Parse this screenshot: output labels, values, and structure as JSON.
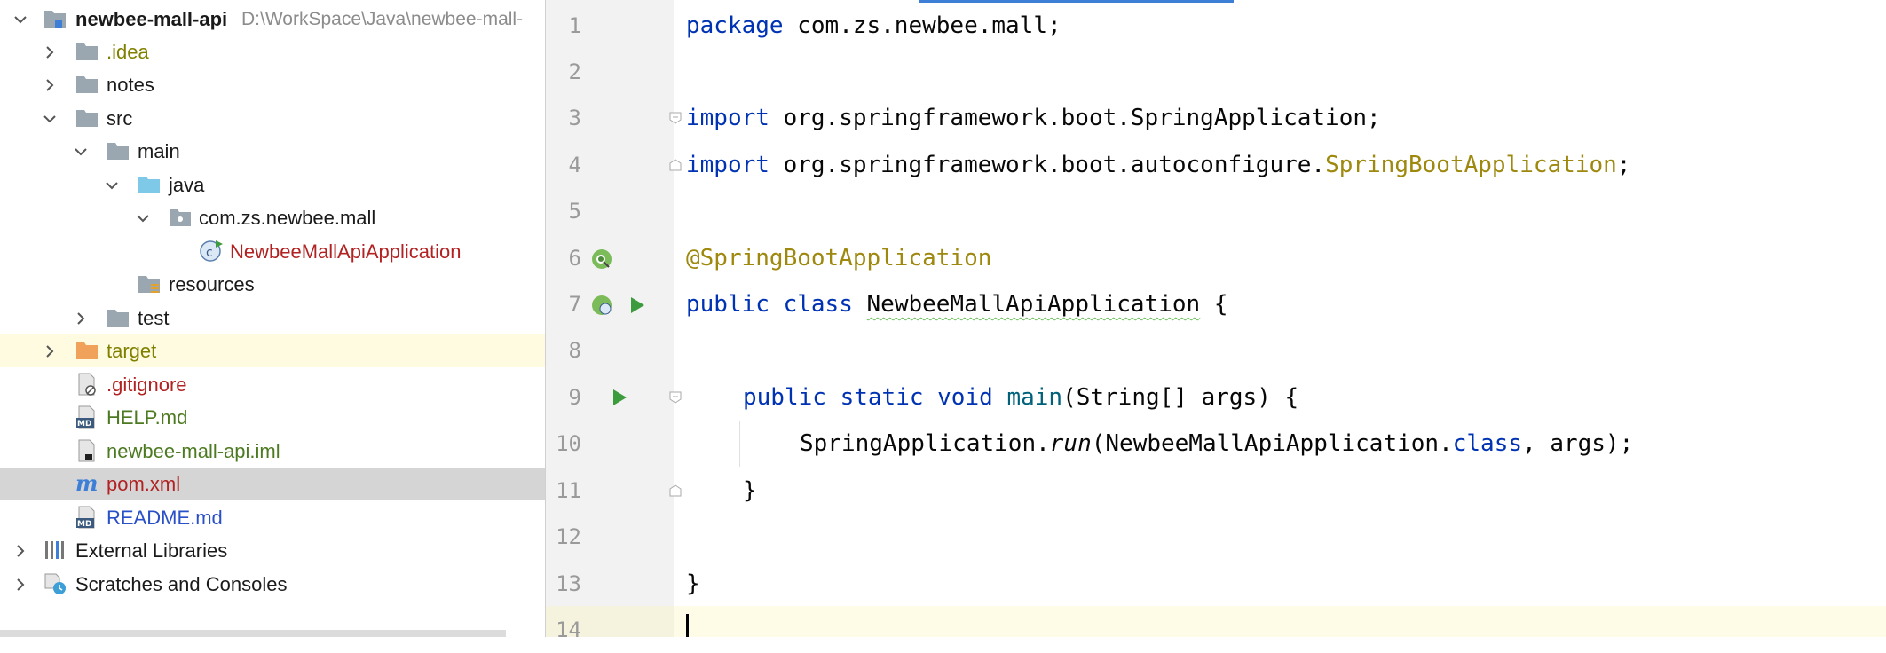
{
  "tree": {
    "root": {
      "label": "newbee-mall-api",
      "path": "D:\\WorkSpace\\Java\\newbee-mall-"
    },
    "items": [
      {
        "label": ".idea"
      },
      {
        "label": "notes"
      },
      {
        "label": "src"
      },
      {
        "label": "main"
      },
      {
        "label": "java"
      },
      {
        "label": "com.zs.newbee.mall"
      },
      {
        "label": "NewbeeMallApiApplication"
      },
      {
        "label": "resources"
      },
      {
        "label": "test"
      },
      {
        "label": "target"
      },
      {
        "label": ".gitignore"
      },
      {
        "label": "HELP.md"
      },
      {
        "label": "newbee-mall-api.iml"
      },
      {
        "label": "pom.xml"
      },
      {
        "label": "README.md"
      },
      {
        "label": "External Libraries"
      },
      {
        "label": "Scratches and Consoles"
      }
    ]
  },
  "editor": {
    "line_numbers": [
      "1",
      "2",
      "3",
      "4",
      "5",
      "6",
      "7",
      "8",
      "9",
      "10",
      "11",
      "12",
      "13",
      "14"
    ],
    "tokens": {
      "l1_kw": "package",
      "l1_rest": " com.zs.newbee.mall;",
      "l3_kw": "import",
      "l3_rest": " org.springframework.boot.SpringApplication;",
      "l4_kw": "import",
      "l4_rest": " org.springframework.boot.autoconfigure.",
      "l4_type": "SpringBootApplication",
      "l4_end": ";",
      "l6_ann": "@SpringBootApplication",
      "l7_kw1": "public",
      "l7_kw2": "class",
      "l7_name": "NewbeeMallApiApplication",
      "l7_end": " {",
      "l9_kw1": "public",
      "l9_kw2": "static",
      "l9_kw3": "void",
      "l9_fn": "main",
      "l9_rest": "(String[] args) {",
      "l10_cls": "SpringApplication.",
      "l10_fn": "run",
      "l10_mid": "(NewbeeMallApiApplication.",
      "l10_kw": "class",
      "l10_end": ", args);",
      "l11": "}",
      "l13": "}"
    }
  },
  "colors": {
    "keyword": "#0033b3",
    "annotation": "#9e880d",
    "selection": "#d5d5d5",
    "highlight_row": "#fefbe0",
    "run_icon": "#3c9b3c"
  },
  "icons": [
    "chevron-down-icon",
    "chevron-right-icon",
    "module-folder-icon",
    "folder-icon",
    "source-folder-icon",
    "package-icon",
    "spring-class-icon",
    "resources-folder-icon",
    "excluded-folder-icon",
    "gitignore-file-icon",
    "markdown-file-icon",
    "iml-file-icon",
    "maven-file-icon",
    "libraries-icon",
    "scratches-icon",
    "run-icon",
    "spring-bean-icon",
    "fold-icon"
  ]
}
